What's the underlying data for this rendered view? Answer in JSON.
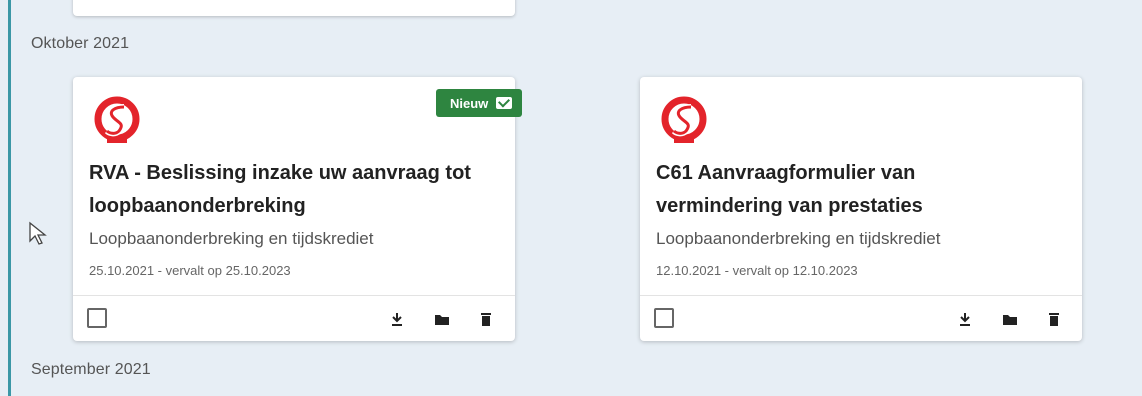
{
  "months": {
    "current": "Oktober 2021",
    "next": "September 2021"
  },
  "cards": [
    {
      "badge": "Nieuw",
      "title_line1": "RVA - Beslissing inzake uw aanvraag tot",
      "title_line2": "loopbaanonderbreking",
      "category": "Loopbaanonderbreking en tijdskrediet",
      "date": "25.10.2021 - vervalt op 25.10.2023"
    },
    {
      "title_line1": "C61 Aanvraagformulier van",
      "title_line2": "vermindering van prestaties",
      "category": "Loopbaanonderbreking en tijdskrediet",
      "date": "12.10.2021 - vervalt op 12.10.2023"
    }
  ],
  "colors": {
    "accent": "#3b97a6",
    "badge": "#2e8540",
    "logo_red": "#e3242b"
  },
  "icons": [
    "rva-logo-icon",
    "mail-icon",
    "download-icon",
    "folder-icon",
    "trash-icon",
    "mouse-cursor-icon"
  ]
}
